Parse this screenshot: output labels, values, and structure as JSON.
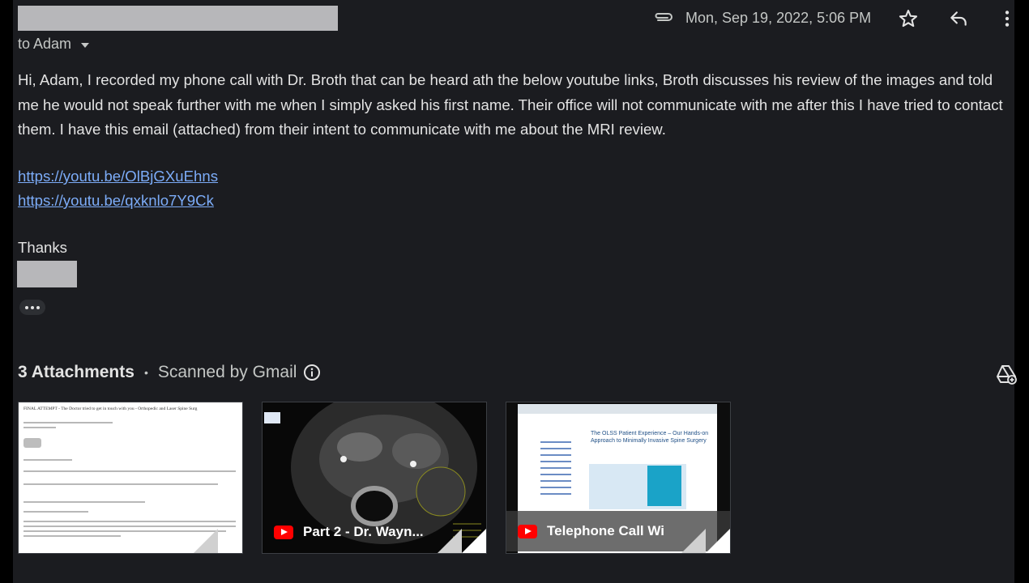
{
  "email": {
    "recipient_line": "to Adam",
    "date": "Mon, Sep 19, 2022, 5:06 PM",
    "body": "Hi, Adam, I recorded my phone call with Dr. Broth that can be heard ath the below youtube links, Broth discusses his review of the images and told me he would not speak further with me when I simply asked his first name. Their office will not communicate with me after this I have tried to contact them. I have this email (attached) from their intent to communicate with me about the MRI review.",
    "links": [
      "https://youtu.be/OlBjGXuEhns",
      "https://youtu.be/qxknlo7Y9Ck"
    ],
    "signoff": "Thanks"
  },
  "toolbar": {
    "icons": [
      "attachment-icon",
      "star-icon",
      "reply-icon",
      "more-vert-icon"
    ]
  },
  "attachments": {
    "count_label": "3 Attachments",
    "separator": "•",
    "scan_label": "Scanned by Gmail",
    "tiles": [
      {
        "type": "document",
        "preview_title": "FINAL ATTEMPT - The Doctor tried to get in touch with you - Orthopedic and Laser Spine Surg"
      },
      {
        "type": "youtube",
        "label": "Part 2 - Dr. Wayn..."
      },
      {
        "type": "youtube",
        "label": "Telephone Call Wi",
        "preview_title": "The OLSS Patient Experience – Our Hands-on Approach to Minimally Invasive Spine Surgery"
      }
    ]
  },
  "colors": {
    "background": "#1b1c20",
    "text": "#e3e3e3",
    "link": "#7cacf8",
    "youtube": "#ff0000"
  }
}
